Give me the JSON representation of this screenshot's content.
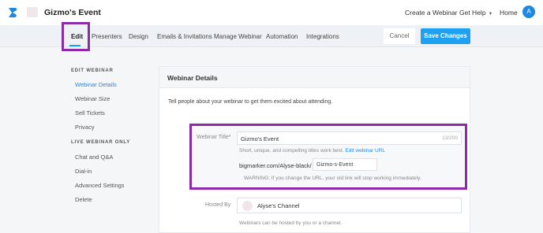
{
  "header": {
    "event_title": "Gizmo's Event",
    "links": [
      "Create a Webinar",
      "Get Help",
      "Home"
    ],
    "avatar_initial": "A"
  },
  "tabs": [
    "Edit",
    "Presenters",
    "Design",
    "Emails & Invitations",
    "Manage Webinar",
    "Automation",
    "Integrations"
  ],
  "actions": {
    "cancel": "Cancel",
    "save": "Save Changes"
  },
  "sidebar": {
    "edit_heading": "EDIT WEBINAR",
    "edit_items": [
      "Webinar Details",
      "Webinar Size",
      "Sell Tickets",
      "Privacy"
    ],
    "live_heading": "LIVE WEBINAR ONLY",
    "live_items": [
      "Chat and Q&A",
      "Dial-in",
      "Advanced Settings",
      "Delete"
    ]
  },
  "panel": {
    "title": "Webinar Details",
    "description": "Tell people about your webinar to get them excited about attending.",
    "webinar_title_label": "Webinar Title*",
    "webinar_title_value": "Gizmo's Event",
    "char_count": "13/200",
    "hint": "Short, unique, and compelling titles work best.",
    "hint_link": "Edit webinar URL",
    "url_prefix": "bigmarker.com/Alyse-black/",
    "url_slug": "Gizmo-s-Event",
    "warning": "WARNING: If you change the URL, your old link will stop working immediately.",
    "hosted_by_label": "Hosted By",
    "hosted_by_value": "Alyse's Channel",
    "hosted_hint": "Webinars can be hosted by you or a channel."
  },
  "colors": {
    "accent": "#1ea1f2",
    "link": "#1e88e5",
    "highlight": "#8e29a8"
  }
}
